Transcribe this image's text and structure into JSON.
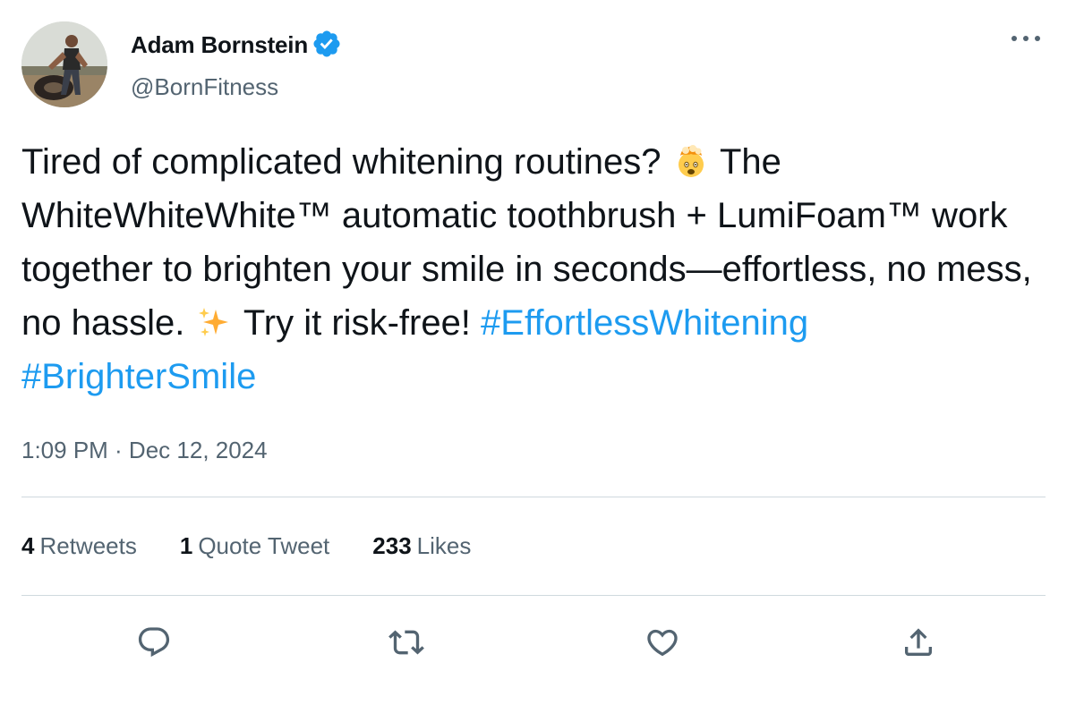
{
  "author": {
    "display_name": "Adam Bornstein",
    "handle": "@BornFitness",
    "verified": true
  },
  "tweet": {
    "segments": [
      {
        "type": "text",
        "value": "Tired of complicated whitening routines? "
      },
      {
        "type": "emoji",
        "icon": "exploding-head-emoji"
      },
      {
        "type": "text",
        "value": " The WhiteWhiteWhite™ automatic toothbrush + LumiFoam™ work together to brighten your smile in seconds—effortless, no mess, no hassle. "
      },
      {
        "type": "emoji",
        "icon": "sparkles-emoji"
      },
      {
        "type": "text",
        "value": " Try it risk-free! "
      },
      {
        "type": "hashtag",
        "value": "#EffortlessWhitening"
      },
      {
        "type": "text",
        "value": " "
      },
      {
        "type": "hashtag",
        "value": "#BrighterSmile"
      }
    ],
    "timestamp": "1:09 PM · Dec 12, 2024"
  },
  "stats": {
    "retweets_count": "4",
    "retweets_label": "Retweets",
    "quotes_count": "1",
    "quotes_label": "Quote Tweet",
    "likes_count": "233",
    "likes_label": "Likes"
  },
  "actions": {
    "reply_icon": "reply-icon",
    "retweet_icon": "retweet-icon",
    "like_icon": "heart-icon",
    "share_icon": "share-icon"
  },
  "colors": {
    "accent": "#1d9bf0",
    "text_primary": "#0f1419",
    "text_secondary": "#536471",
    "divider": "#cfd9de"
  }
}
